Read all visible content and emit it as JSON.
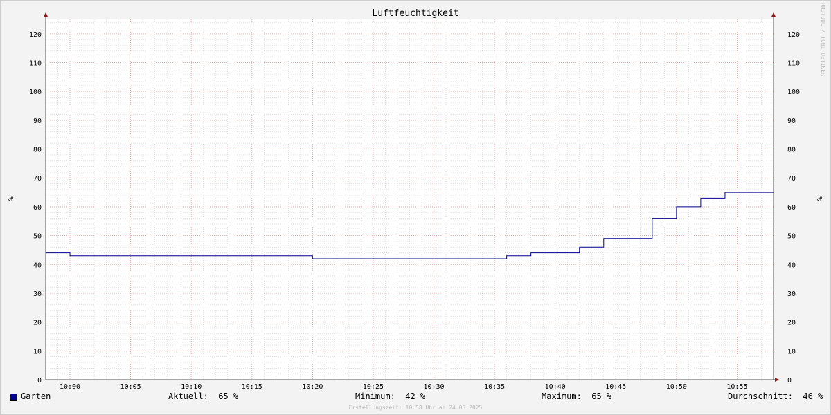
{
  "chart_data": {
    "type": "line",
    "title": "Luftfeuchtigkeit",
    "ylabel": "%",
    "ylabel_right": "%",
    "ylim": [
      0,
      125
    ],
    "yticks": [
      0,
      10,
      20,
      30,
      40,
      50,
      60,
      70,
      80,
      90,
      100,
      110,
      120
    ],
    "xlim": [
      "09:58",
      "10:58"
    ],
    "xticks": [
      "10:00",
      "10:05",
      "10:10",
      "10:15",
      "10:20",
      "10:25",
      "10:30",
      "10:35",
      "10:40",
      "10:45",
      "10:50",
      "10:55"
    ],
    "grid": true,
    "series": [
      {
        "name": "Garten",
        "color": "#00008b",
        "step": true,
        "points": [
          [
            "09:58",
            44
          ],
          [
            "10:00",
            43
          ],
          [
            "10:20",
            42
          ],
          [
            "10:36",
            43
          ],
          [
            "10:38",
            44
          ],
          [
            "10:42",
            46
          ],
          [
            "10:44",
            49
          ],
          [
            "10:48",
            56
          ],
          [
            "10:50",
            60
          ],
          [
            "10:52",
            63
          ],
          [
            "10:54",
            65
          ],
          [
            "10:58",
            65
          ]
        ]
      }
    ]
  },
  "legend": {
    "series_name": "Garten",
    "current": "Aktuell:  65 %",
    "minimum": "Minimum:  42 %",
    "maximum": "Maximum:  65 %",
    "average": "Durchschnitt:  46 %"
  },
  "footer": "Erstellungszeit: 10:58 Uhr am 24.05.2025",
  "watermark": "RRDTOOL / TOBI OETIKER",
  "colors": {
    "line": "#00008b",
    "major_grid": "#e8a0a0",
    "minor_grid": "#d0d0d0",
    "axis": "#555555",
    "arrow": "#8b1a1a"
  }
}
